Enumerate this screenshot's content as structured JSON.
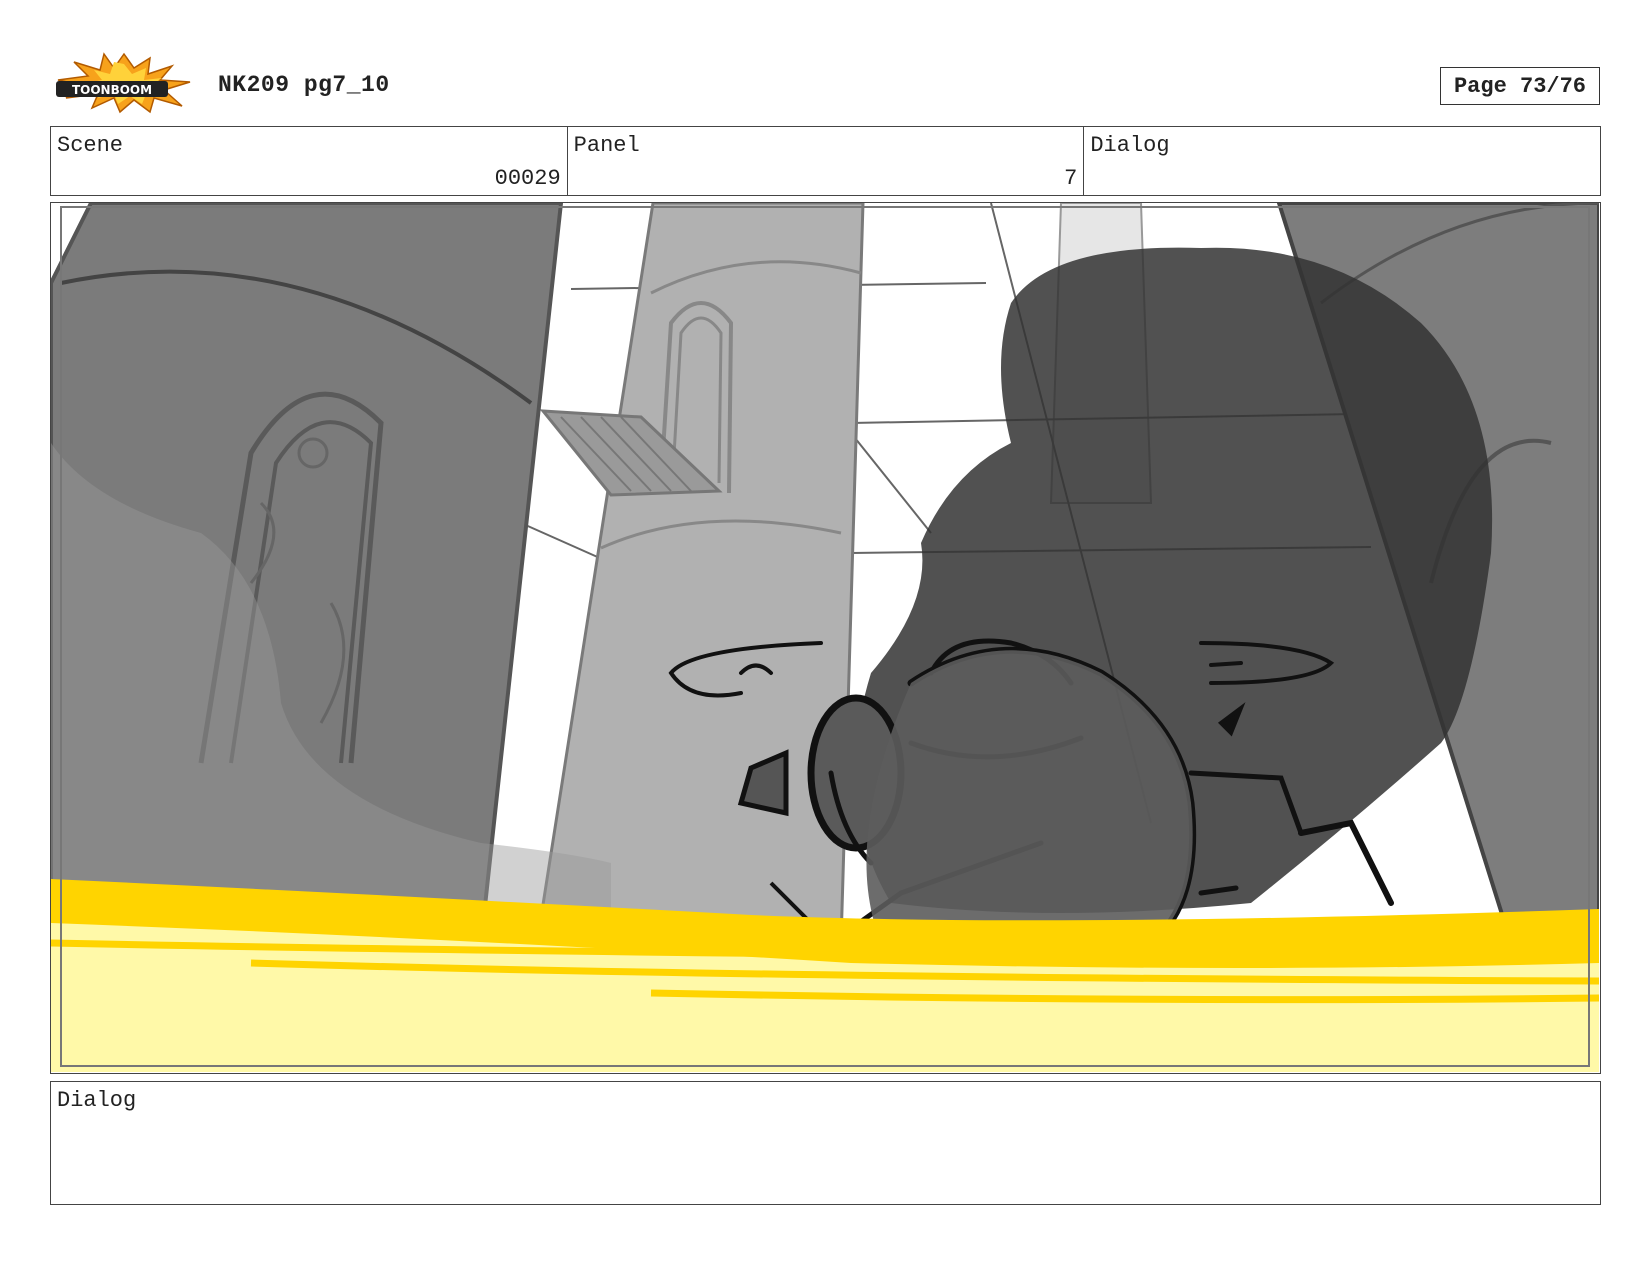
{
  "header": {
    "logo_text": "TOONBOOM",
    "title": "NK209 pg7_10",
    "page_label": "Page 73/76"
  },
  "info": {
    "scene_label": "Scene",
    "scene_value": "00029",
    "panel_label": "Panel",
    "panel_value": "7",
    "dialog_label": "Dialog",
    "dialog_value": ""
  },
  "dialog_box": {
    "label": "Dialog",
    "text": ""
  },
  "colors": {
    "flash_yellow": "#ffd400",
    "pale_yellow": "#fff9a8",
    "shadow_dark": "#3a3a3a",
    "logo_orange": "#f7a21b"
  }
}
